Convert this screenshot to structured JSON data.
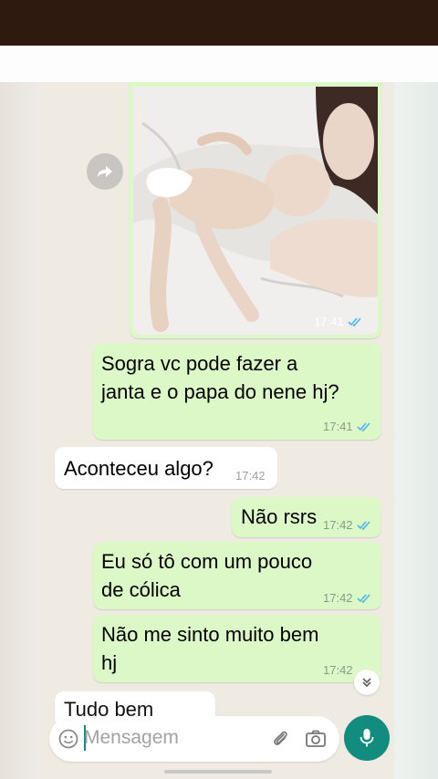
{
  "photo_message": {
    "time": "17:41",
    "status": "read"
  },
  "messages": [
    {
      "direction": "out",
      "text": "Sogra vc pode fazer a\njanta e o papa do nene hj?",
      "time": "17:41",
      "status": "read"
    },
    {
      "direction": "in",
      "text": "Aconteceu algo?",
      "time": "17:42"
    },
    {
      "direction": "out",
      "text": "Não rsrs",
      "time": "17:42",
      "status": "read"
    },
    {
      "direction": "out",
      "text": "Eu só tô com um pouco\nde cólica",
      "time": "17:42",
      "status": "read"
    },
    {
      "direction": "out",
      "text": "Não me sinto muito bem\nhj",
      "time": "17:42",
      "status": "read"
    },
    {
      "direction": "in",
      "text": "Tudo bem",
      "time": ""
    }
  ],
  "input": {
    "placeholder": "Mensagem"
  },
  "icons": {
    "forward": "forward-icon",
    "emoji": "emoji-icon",
    "attach": "paperclip-icon",
    "camera": "camera-icon",
    "mic": "microphone-icon",
    "scroll": "chevron-double-down-icon",
    "read_ticks": "double-check-icon"
  },
  "colors": {
    "outgoing": "#dcf8c6",
    "incoming": "#ffffff",
    "accent": "#128c7e",
    "read_tick": "#4fb6ec"
  }
}
